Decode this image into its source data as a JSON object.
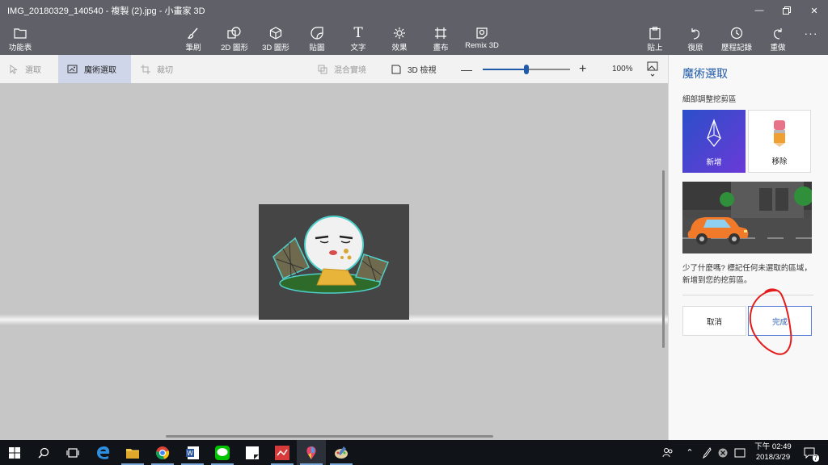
{
  "window": {
    "title": "IMG_20180329_140540 - 複製 (2).jpg - 小畫家 3D",
    "minimize_icon": "minimize-icon",
    "maximize_icon": "restore-icon",
    "close_icon": "close-icon"
  },
  "ribbon": {
    "menu_label": "功能表",
    "tools": [
      {
        "label": "筆刷",
        "icon": "brush-icon"
      },
      {
        "label": "2D 圖形",
        "icon": "2d-shapes-icon"
      },
      {
        "label": "3D 圖形",
        "icon": "3d-shapes-icon"
      },
      {
        "label": "貼圖",
        "icon": "stickers-icon"
      },
      {
        "label": "文字",
        "icon": "text-icon"
      },
      {
        "label": "效果",
        "icon": "effects-icon"
      },
      {
        "label": "畫布",
        "icon": "canvas-icon"
      },
      {
        "label": "Remix 3D",
        "icon": "remix-3d-icon"
      }
    ],
    "right_tools": [
      {
        "label": "貼上",
        "icon": "paste-icon"
      },
      {
        "label": "復原",
        "icon": "undo-icon"
      },
      {
        "label": "歷程記錄",
        "icon": "history-icon"
      },
      {
        "label": "重做",
        "icon": "redo-icon"
      }
    ],
    "more_icon": "more-icon"
  },
  "subbar": {
    "select_label": "選取",
    "magic_select_label": "魔術選取",
    "crop_label": "裁切",
    "mixed_reality_label": "混合實境",
    "view_3d_label": "3D 檢視",
    "zoom_value": "100%",
    "zoom_fraction": 0.5
  },
  "panel": {
    "title": "魔術選取",
    "subtitle": "細部調整挖剪區",
    "add_label": "新增",
    "remove_label": "移除",
    "hint": "少了什麼嗎? 標記任何未選取的區域，新增到您的挖剪區。",
    "cancel_label": "取消",
    "done_label": "完成"
  },
  "taskbar": {
    "clock_time": "下午 02:49",
    "clock_date": "2018/3/29",
    "notification_count": "7",
    "apps": [
      "start-icon",
      "search-icon",
      "task-view-icon",
      "edge-icon",
      "file-explorer-icon",
      "chrome-icon",
      "word-icon",
      "line-icon",
      "sticky-notes-icon",
      "photo-editor-icon",
      "paint-3d-icon",
      "paint-icon"
    ]
  },
  "colors": {
    "titlebar": "#5f6068",
    "accent": "#1e5aa8",
    "canvas_bg": "#c6c6c6"
  }
}
